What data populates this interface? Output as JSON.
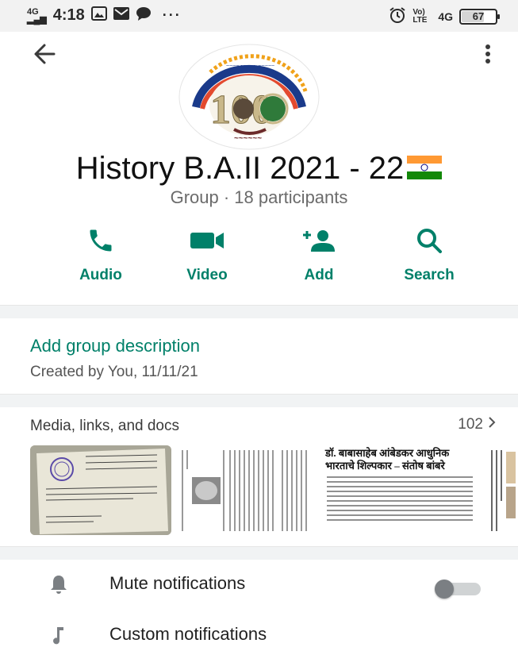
{
  "status_bar": {
    "network": "4G",
    "time": "4:18",
    "right_network": "Vo) LTE",
    "right_4g": "4G",
    "battery_level": "67",
    "battery_fraction": 0.67
  },
  "header": {
    "back_icon": "arrow-left-icon",
    "menu_icon": "more-vert-icon"
  },
  "group": {
    "name": "History B.A.II 2021 - 22",
    "subtitle": "Group · 18 participants",
    "avatar_number": "100"
  },
  "actions": [
    {
      "label": "Audio",
      "icon": "phone-icon"
    },
    {
      "label": "Video",
      "icon": "video-camera-icon"
    },
    {
      "label": "Add",
      "icon": "add-person-icon"
    },
    {
      "label": "Search",
      "icon": "search-icon"
    }
  ],
  "description": {
    "add_label": "Add group description",
    "created": "Created by You, 11/11/21"
  },
  "media": {
    "title": "Media, links, and docs",
    "count": "102",
    "thumb3_heading_line1": "डॉ. बाबासाहेब आंबेडकर आधुनिक",
    "thumb3_heading_line2": "भारताचे शिल्पकार – संतोष बांबरे"
  },
  "settings": [
    {
      "label": "Mute notifications",
      "icon": "bell-icon",
      "toggle_on": false
    },
    {
      "label": "Custom notifications",
      "icon": "music-note-icon"
    }
  ],
  "colors": {
    "accent": "#008069",
    "text_primary": "#111111",
    "text_secondary": "#6b6b6b"
  }
}
